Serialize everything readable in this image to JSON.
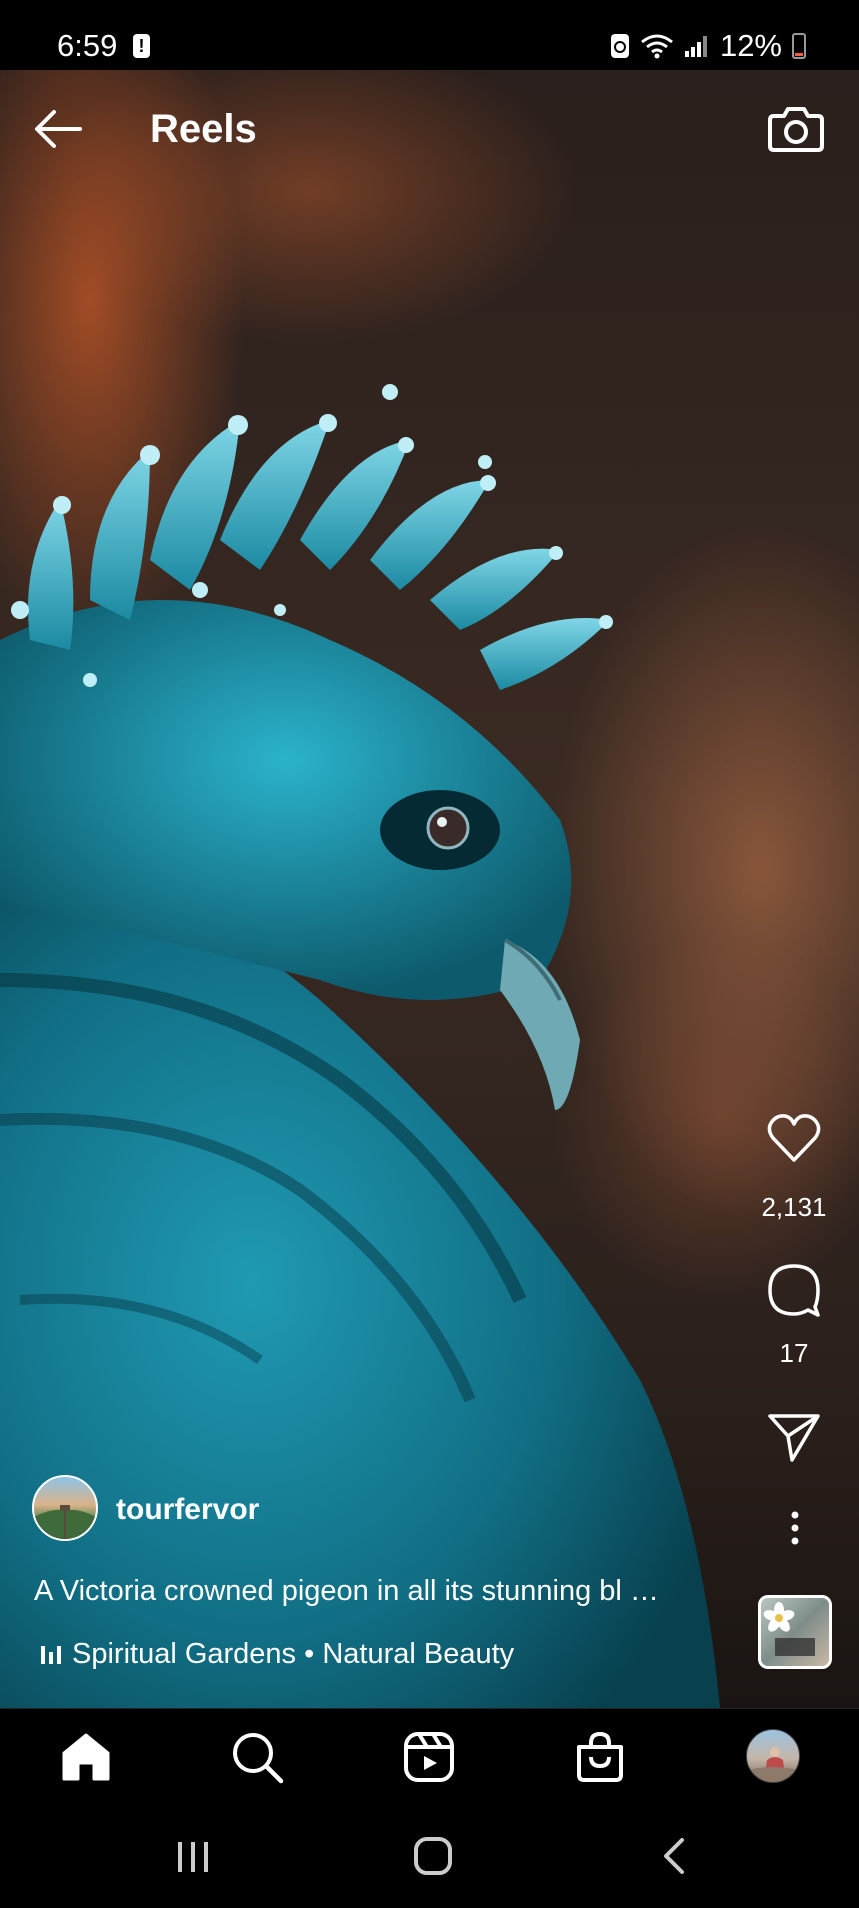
{
  "status_bar": {
    "time": "6:59",
    "battery_pct": "12%"
  },
  "header": {
    "title": "Reels"
  },
  "actions": {
    "likes": "2,131",
    "comments": "17"
  },
  "post": {
    "username": "tourfervor",
    "caption": "A Victoria crowned pigeon in all its stunning bl …",
    "audio": "Spiritual Gardens • Natural Beauty"
  },
  "icons": {
    "back": "back-arrow-icon",
    "camera": "camera-icon",
    "like": "heart-icon",
    "comment": "comment-bubble-icon",
    "share": "paper-plane-icon",
    "more": "more-vertical-icon",
    "home": "home-icon",
    "search": "search-icon",
    "reels": "reels-icon",
    "shop": "shopping-bag-icon"
  },
  "colors": {
    "accent": "#ffffff",
    "battery_low": "#ff5a3c",
    "bird_teal": "#1e8ea6"
  }
}
